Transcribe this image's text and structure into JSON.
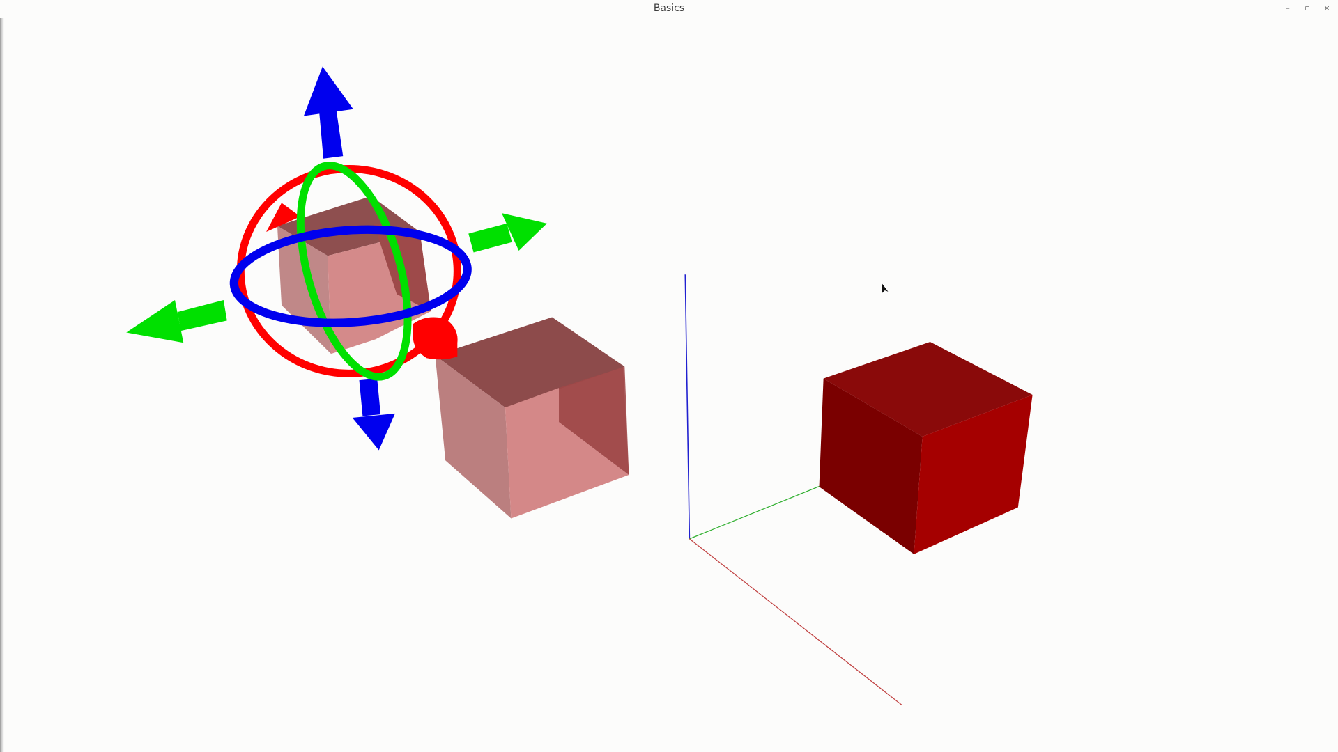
{
  "window": {
    "title": "Basics",
    "controls": {
      "minimize": "–",
      "maximize": "▫",
      "close": "×"
    }
  },
  "scene": {
    "background": "#fcfcfb",
    "objects": [
      {
        "name": "selected-cube",
        "color": "#c97a7a",
        "state": "selected"
      },
      {
        "name": "translucent-cube",
        "color": "#c98080",
        "state": "translucent"
      },
      {
        "name": "solid-cube",
        "color": "#a40000",
        "state": "opaque"
      }
    ],
    "axes": {
      "x_color": "#c04040",
      "y_color": "#30b030",
      "z_color": "#2020d0"
    },
    "gizmo": {
      "rotation_ring_colors": [
        "#ff0000",
        "#00e000",
        "#0000ee"
      ],
      "translate_arrow_colors": {
        "up_down": "#0000ee",
        "left_right": "#00e000"
      }
    },
    "cursor_icon": "mouse-pointer-icon"
  }
}
